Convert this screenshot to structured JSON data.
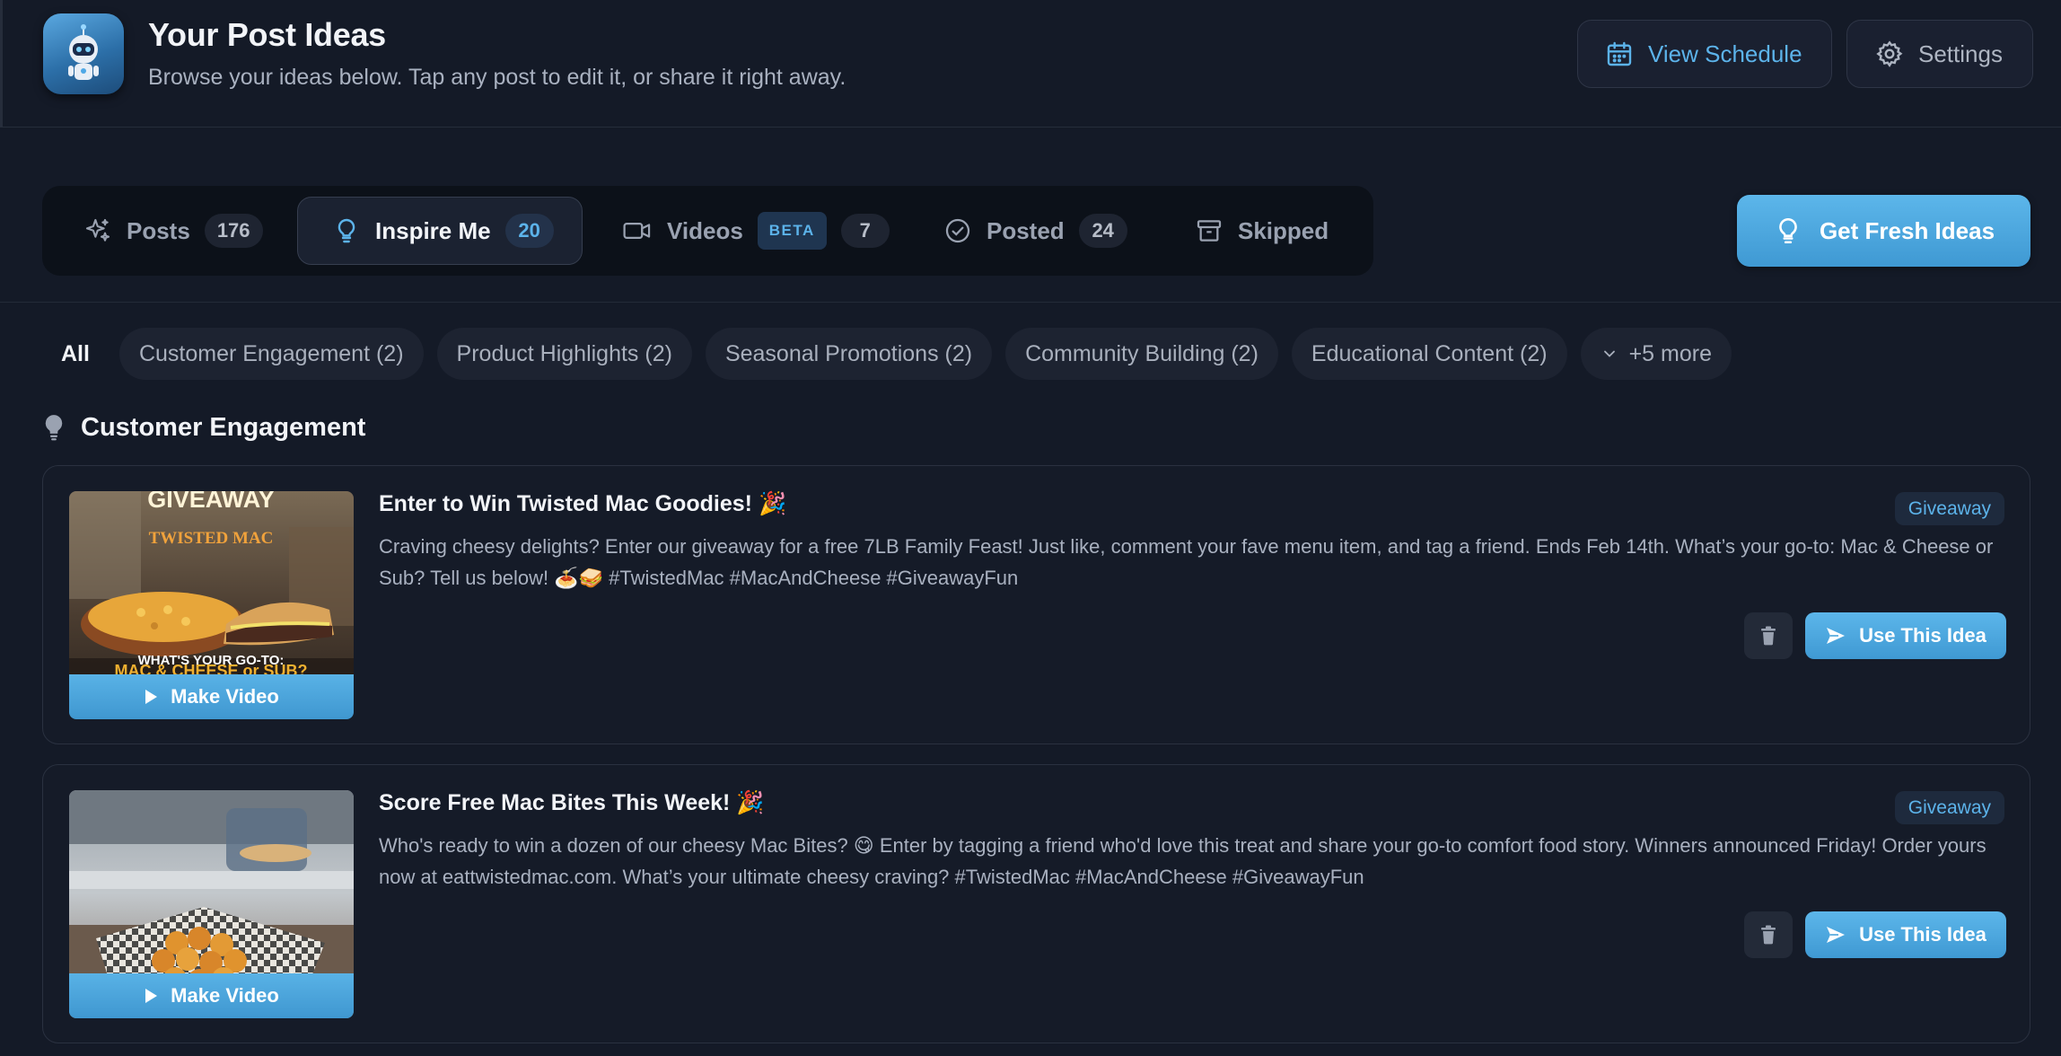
{
  "header": {
    "title": "Your Post Ideas",
    "subtitle": "Browse your ideas below. Tap any post to edit it, or share it right away.",
    "view_schedule_label": "View Schedule",
    "settings_label": "Settings"
  },
  "tabs": [
    {
      "label": "Posts",
      "count": "176",
      "icon": "sparkles-icon"
    },
    {
      "label": "Inspire Me",
      "count": "20",
      "icon": "lightbulb-icon",
      "active": true
    },
    {
      "label": "Videos",
      "badge": "BETA",
      "count": "7",
      "icon": "video-camera-icon"
    },
    {
      "label": "Posted",
      "count": "24",
      "icon": "check-circle-icon"
    },
    {
      "label": "Skipped",
      "icon": "archive-icon"
    }
  ],
  "fresh_ideas_label": "Get Fresh Ideas",
  "filters": {
    "all": "All",
    "chips": [
      "Customer Engagement (2)",
      "Product Highlights (2)",
      "Seasonal Promotions (2)",
      "Community Building (2)",
      "Educational Content (2)"
    ],
    "more": "+5 more"
  },
  "section": {
    "title": "Customer Engagement"
  },
  "cards": [
    {
      "title": "Enter to Win Twisted Mac Goodies! 🎉",
      "body": "Craving cheesy delights? Enter our giveaway for a free 7LB Family Feast! Just like, comment your fave menu item, and tag a friend. Ends Feb 14th. What’s your go-to: Mac & Cheese or Sub? Tell us below! 🍝🥪 #TwistedMac #MacAndCheese #GiveawayFun",
      "tag": "Giveaway",
      "make_video": "Make Video",
      "use_label": "Use This Idea",
      "image_text": {
        "headline": "GIVEAWAY",
        "brand": "TWISTED MAC",
        "caption_top": "WHAT'S YOUR GO-TO:",
        "caption_bottom": "MAC & CHEESE or SUB?"
      }
    },
    {
      "title": "Score Free Mac Bites This Week! 🎉",
      "body": "Who's ready to win a dozen of our cheesy Mac Bites? 😋 Enter by tagging a friend who'd love this treat and share your go-to comfort food story. Winners announced Friday! Order yours now at eattwistedmac.com. What’s your ultimate cheesy craving? #TwistedMac #MacAndCheese #GiveawayFun",
      "tag": "Giveaway",
      "make_video": "Make Video",
      "use_label": "Use This Idea"
    }
  ],
  "colors": {
    "background": "#141a27",
    "accent": "#5cb3ea",
    "card_border": "#2a3140"
  }
}
